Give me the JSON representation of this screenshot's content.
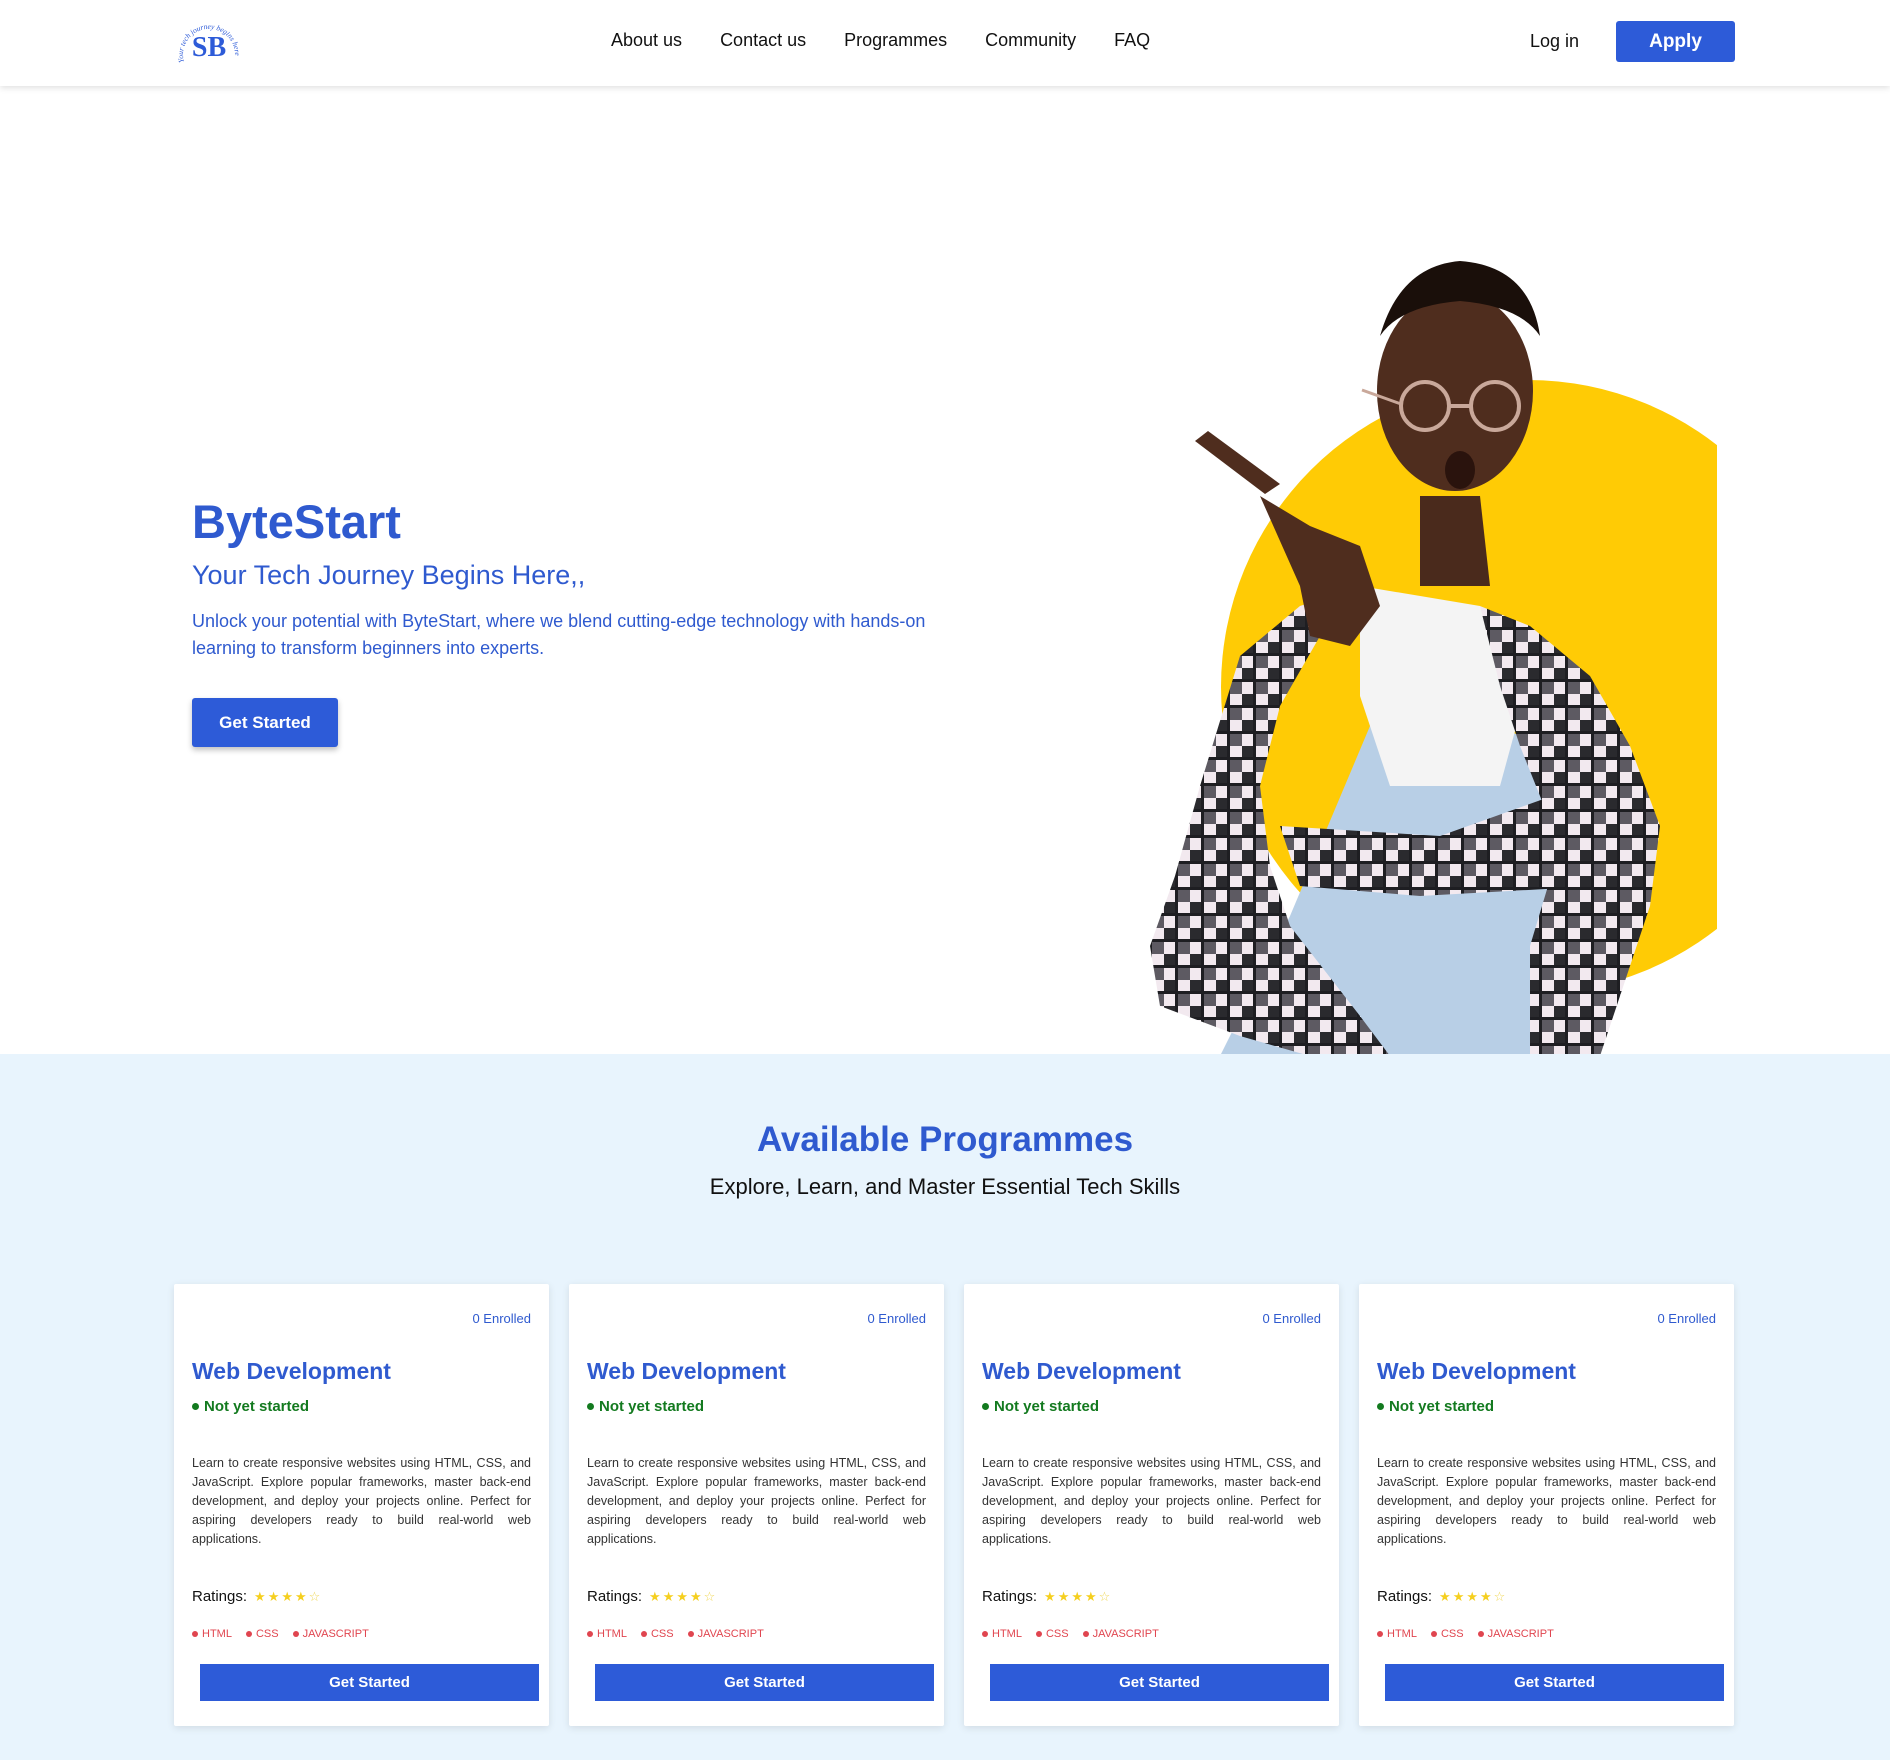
{
  "brand": {
    "logo_text": "SB",
    "logo_tagline": "Your tech journey begins here",
    "primary_color": "#2d5bd8",
    "accent_yellow": "#ffcb05"
  },
  "nav": {
    "links": [
      "About us",
      "Contact us",
      "Programmes",
      "Community",
      "FAQ"
    ],
    "login": "Log in",
    "apply": "Apply"
  },
  "hero": {
    "title": "ByteStart",
    "subtitle": "Your Tech Journey Begins Here,,",
    "description": "Unlock your potential with ByteStart, where we blend cutting-edge technology with hands-on learning to transform beginners into experts.",
    "cta": "Get Started"
  },
  "programmes": {
    "title": "Available Programmes",
    "subtitle": "Explore, Learn, and Master Essential Tech Skills",
    "cards": [
      {
        "enrolled": "0 Enrolled",
        "title": "Web Development",
        "status": "Not yet started",
        "description": "Learn to create responsive websites using HTML, CSS, and JavaScript. Explore popular frameworks, master back-end development, and deploy your projects online. Perfect for aspiring developers ready to build real-world web applications.",
        "ratings_label": "Ratings:",
        "rating": 4,
        "rating_max": 5,
        "tags": [
          "HTML",
          "CSS",
          "JAVASCRIPT"
        ],
        "cta": "Get Started"
      },
      {
        "enrolled": "0 Enrolled",
        "title": "Web Development",
        "status": "Not yet started",
        "description": "Learn to create responsive websites using HTML, CSS, and JavaScript. Explore popular frameworks, master back-end development, and deploy your projects online. Perfect for aspiring developers ready to build real-world web applications.",
        "ratings_label": "Ratings:",
        "rating": 4,
        "rating_max": 5,
        "tags": [
          "HTML",
          "CSS",
          "JAVASCRIPT"
        ],
        "cta": "Get Started"
      },
      {
        "enrolled": "0 Enrolled",
        "title": "Web Development",
        "status": "Not yet started",
        "description": "Learn to create responsive websites using HTML, CSS, and JavaScript. Explore popular frameworks, master back-end development, and deploy your projects online. Perfect for aspiring developers ready to build real-world web applications.",
        "ratings_label": "Ratings:",
        "rating": 4,
        "rating_max": 5,
        "tags": [
          "HTML",
          "CSS",
          "JAVASCRIPT"
        ],
        "cta": "Get Started"
      },
      {
        "enrolled": "0 Enrolled",
        "title": "Web Development",
        "status": "Not yet started",
        "description": "Learn to create responsive websites using HTML, CSS, and JavaScript. Explore popular frameworks, master back-end development, and deploy your projects online. Perfect for aspiring developers ready to build real-world web applications.",
        "ratings_label": "Ratings:",
        "rating": 4,
        "rating_max": 5,
        "tags": [
          "HTML",
          "CSS",
          "JAVASCRIPT"
        ],
        "cta": "Get Started"
      }
    ]
  }
}
